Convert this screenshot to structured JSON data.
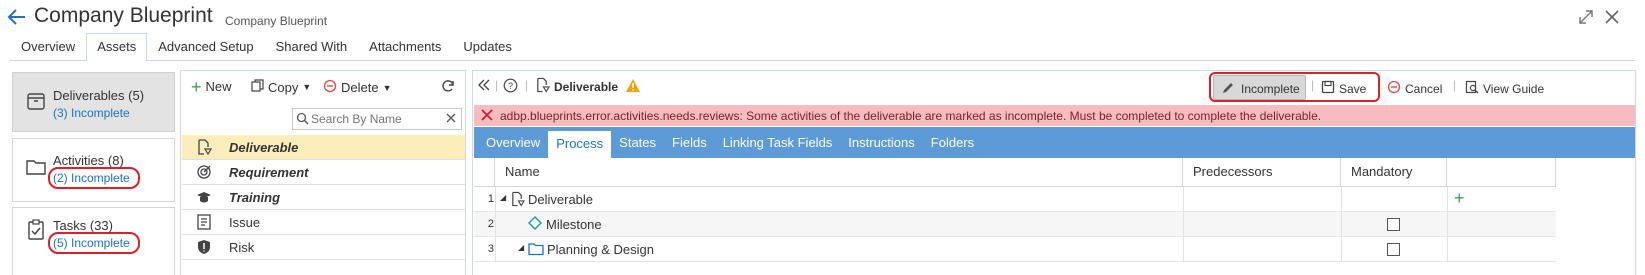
{
  "header": {
    "title": "Company Blueprint",
    "subtitle": "Company Blueprint"
  },
  "top_tabs": [
    {
      "label": "Overview",
      "active": false
    },
    {
      "label": "Assets",
      "active": true
    },
    {
      "label": "Advanced Setup",
      "active": false
    },
    {
      "label": "Shared With",
      "active": false
    },
    {
      "label": "Attachments",
      "active": false
    },
    {
      "label": "Updates",
      "active": false
    }
  ],
  "assets": [
    {
      "title": "Deliverables (5)",
      "sub": "(3) Incomplete",
      "icon": "archive-box-icon",
      "active": true
    },
    {
      "title": "Activities (8)",
      "sub": "(2) Incomplete",
      "icon": "folder-icon",
      "active": false
    },
    {
      "title": "Tasks (33)",
      "sub": "(5) Incomplete",
      "icon": "clipboard-check-icon",
      "active": false
    }
  ],
  "list_toolbar": {
    "new_label": "New",
    "copy_label": "Copy",
    "delete_label": "Delete"
  },
  "search": {
    "placeholder": "Search By Name"
  },
  "list_items": [
    {
      "label": "Deliverable",
      "icon": "deliverable-doc-icon",
      "style": "italic-bold",
      "selected": true
    },
    {
      "label": "Requirement",
      "icon": "target-icon",
      "style": "italic-bold",
      "selected": false
    },
    {
      "label": "Training",
      "icon": "graduation-cap-icon",
      "style": "italic-bold",
      "selected": false
    },
    {
      "label": "Issue",
      "icon": "document-lines-icon",
      "style": "normal",
      "selected": false
    },
    {
      "label": "Risk",
      "icon": "shield-icon",
      "style": "normal",
      "selected": false
    }
  ],
  "detail_toolbar": {
    "item_label": "Deliverable",
    "incomplete_label": "Incomplete",
    "save_label": "Save",
    "cancel_label": "Cancel",
    "view_guide_label": "View Guide"
  },
  "error": {
    "message": "adbp.blueprints.error.activities.needs.reviews: Some activities of the deliverable are marked as incomplete. Must be completed to complete the deliverable."
  },
  "detail_tabs": [
    {
      "label": "Overview",
      "active": false
    },
    {
      "label": "Process",
      "active": true
    },
    {
      "label": "States",
      "active": false
    },
    {
      "label": "Fields",
      "active": false
    },
    {
      "label": "Linking Task Fields",
      "active": false
    },
    {
      "label": "Instructions",
      "active": false
    },
    {
      "label": "Folders",
      "active": false
    }
  ],
  "grid": {
    "columns": [
      "Name",
      "Predecessors",
      "Mandatory"
    ],
    "rows": [
      {
        "num": "1",
        "name": "Deliverable",
        "icon": "deliverable-doc-icon",
        "expand": true,
        "mandatory_checkbox": false
      },
      {
        "num": "2",
        "name": "Milestone",
        "icon": "diamond-icon",
        "expand": false,
        "mandatory_checkbox": true
      },
      {
        "num": "3",
        "name": "Planning & Design",
        "icon": "folder-icon",
        "expand": true,
        "mandatory_checkbox": true
      }
    ]
  },
  "colors": {
    "accent": "#1a73c6",
    "tab_bar": "#5d9bd8",
    "error_bg": "#f7bcbf",
    "highlight_ring": "#e01e2a",
    "selected_row": "#fbeeba",
    "add_green": "#3aa657",
    "warning": "#f0a30a"
  }
}
